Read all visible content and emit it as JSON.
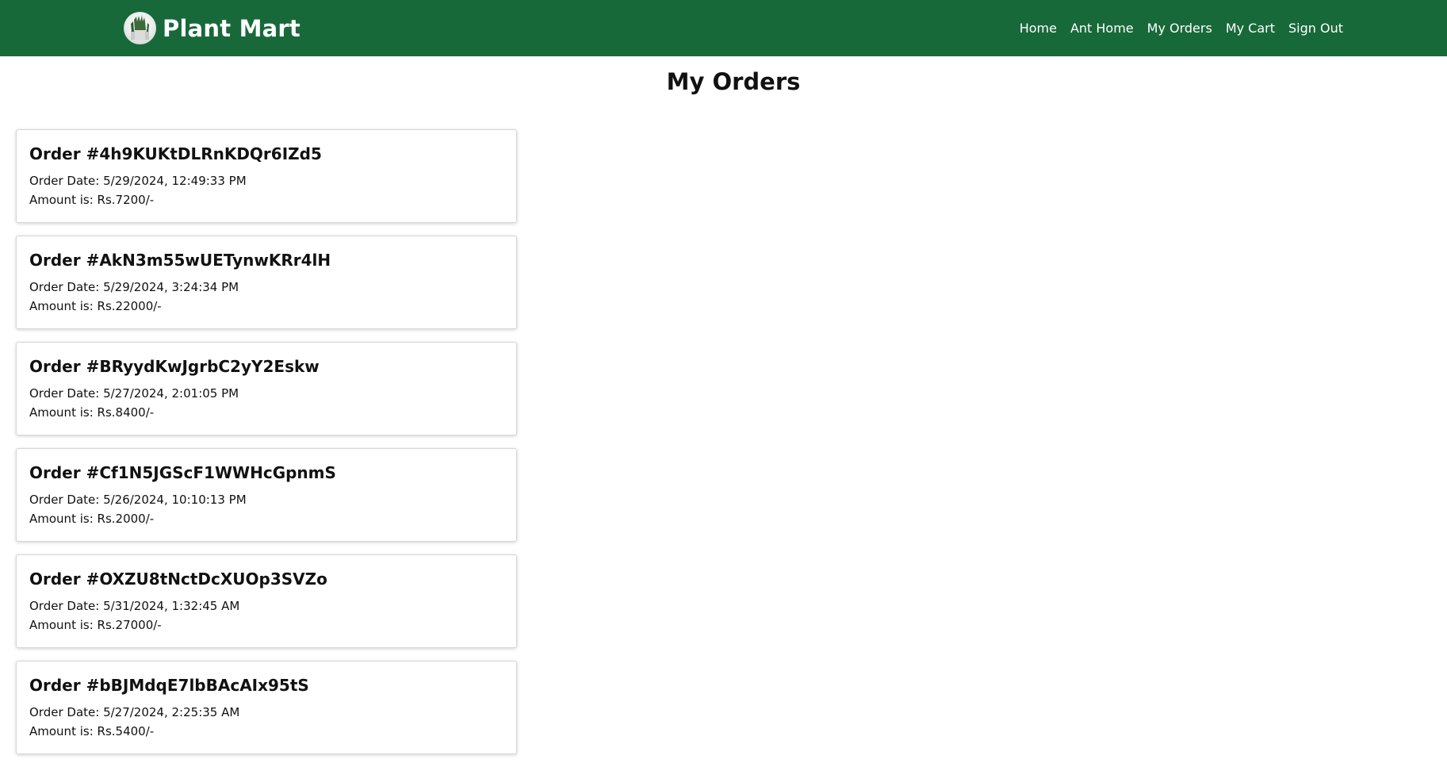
{
  "navbar": {
    "brand": "Plant Mart",
    "logo_icon": "plant-logo-icon",
    "background": "#18693a",
    "links": [
      {
        "label": "Home"
      },
      {
        "label": "Ant Home"
      },
      {
        "label": "My Orders"
      },
      {
        "label": "My Cart"
      },
      {
        "label": "Sign Out"
      }
    ]
  },
  "page": {
    "title": "My Orders"
  },
  "orders": [
    {
      "title": "Order #4h9KUKtDLRnKDQr6IZd5",
      "date": "Order Date: 5/29/2024, 12:49:33 PM",
      "amount": "Amount is: Rs.7200/-"
    },
    {
      "title": "Order #AkN3m55wUETynwKRr4lH",
      "date": "Order Date: 5/29/2024, 3:24:34 PM",
      "amount": "Amount is: Rs.22000/-"
    },
    {
      "title": "Order #BRyydKwJgrbC2yY2Eskw",
      "date": "Order Date: 5/27/2024, 2:01:05 PM",
      "amount": "Amount is: Rs.8400/-"
    },
    {
      "title": "Order #Cf1N5JGScF1WWHcGpnmS",
      "date": "Order Date: 5/26/2024, 10:10:13 PM",
      "amount": "Amount is: Rs.2000/-"
    },
    {
      "title": "Order #OXZU8tNctDcXUOp3SVZo",
      "date": "Order Date: 5/31/2024, 1:32:45 AM",
      "amount": "Amount is: Rs.27000/-"
    },
    {
      "title": "Order #bBJMdqE7lbBAcAIx95tS",
      "date": "Order Date: 5/27/2024, 2:25:35 AM",
      "amount": "Amount is: Rs.5400/-"
    }
  ]
}
